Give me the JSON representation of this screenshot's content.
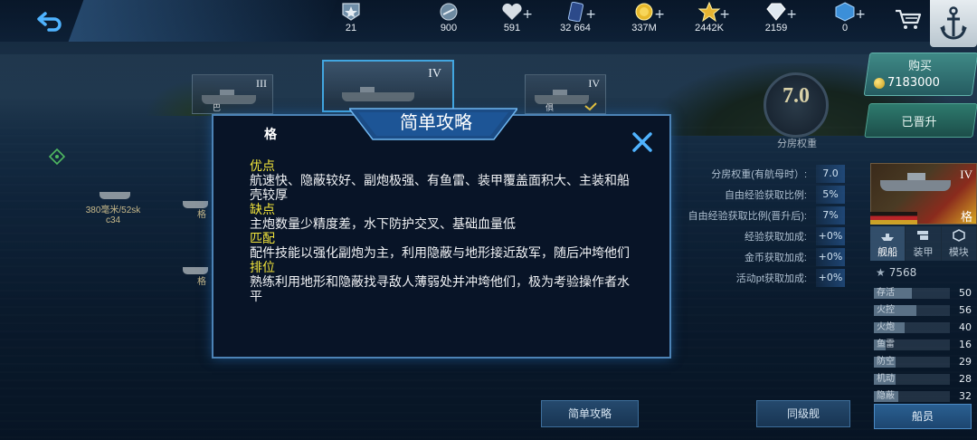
{
  "topbar": {
    "resources": [
      {
        "icon": "rank-badge-icon",
        "value": "21",
        "plus": false
      },
      {
        "icon": "ship-parts-icon",
        "value": "900",
        "plus": false
      },
      {
        "icon": "heart-icon",
        "value": "591",
        "plus": true
      },
      {
        "icon": "card-icon",
        "value": "32 664",
        "plus": true
      },
      {
        "icon": "gold-coin-icon",
        "value": "337M",
        "plus": true
      },
      {
        "icon": "star-icon",
        "value": "2442K",
        "plus": true
      },
      {
        "icon": "diamond-icon",
        "value": "2159",
        "plus": true
      },
      {
        "icon": "cube-icon",
        "value": "0",
        "plus": true
      }
    ]
  },
  "ship_tabs": [
    {
      "tier": "III",
      "name": "巴"
    },
    {
      "tier": "IV",
      "name": ""
    },
    {
      "tier": "IV",
      "name": "俱"
    }
  ],
  "left_labels": {
    "ship1_line1": "380毫米/52sk",
    "ship1_line2": "c34",
    "ship2": "格",
    "ship3": "格"
  },
  "dialog": {
    "title": "简单攻略",
    "ship_name": "格",
    "sections": [
      {
        "head": "优点",
        "body": "航速快、隐蔽较好、副炮极强、有鱼雷、装甲覆盖面积大、主装和船壳较厚"
      },
      {
        "head": "缺点",
        "body": "主炮数量少精度差，水下防护交叉、基础血量低"
      },
      {
        "head": "匹配",
        "body": "配件技能以强化副炮为主，利用隐蔽与地形接近敌军，随后冲垮他们"
      },
      {
        "head": "排位",
        "body": "熟练利用地形和隐蔽找寻敌人薄弱处并冲垮他们，极为考验操作者水平"
      }
    ]
  },
  "weight": {
    "value": "7.0",
    "label": "分房权重"
  },
  "stats": [
    {
      "label": "分房权重(有航母时）:",
      "value": "7.0"
    },
    {
      "label": "自由经验获取比例:",
      "value": "5%"
    },
    {
      "label": "自由经验获取比例(晋升后):",
      "value": "7%"
    },
    {
      "label": "经验获取加成:",
      "value": "+0%"
    },
    {
      "label": "金币获取加成:",
      "value": "+0%"
    },
    {
      "label": "活动pt获取加成:",
      "value": "+0%"
    }
  ],
  "right_panel": {
    "buy_label": "购买",
    "buy_price": "7183000",
    "promoted_label": "已晋升",
    "card_tier": "IV",
    "card_name": "格",
    "tabs": [
      {
        "icon": "ship-icon",
        "label": "舰船"
      },
      {
        "icon": "armor-icon",
        "label": "装甲"
      },
      {
        "icon": "module-icon",
        "label": "模块"
      }
    ],
    "score": "7568",
    "attributes": [
      {
        "label": "存活",
        "value": "50"
      },
      {
        "label": "火控",
        "value": "56"
      },
      {
        "label": "火炮",
        "value": "40"
      },
      {
        "label": "鱼雷",
        "value": "16"
      },
      {
        "label": "防空",
        "value": "29"
      },
      {
        "label": "机动",
        "value": "28"
      },
      {
        "label": "隐蔽",
        "value": "32"
      }
    ],
    "crew_label": "船员"
  },
  "bottom": {
    "guide_label": "简单攻略",
    "same_class_label": "同级舰"
  },
  "colors": {
    "accent": "#42a6e0",
    "highlight": "#f2e53b"
  }
}
